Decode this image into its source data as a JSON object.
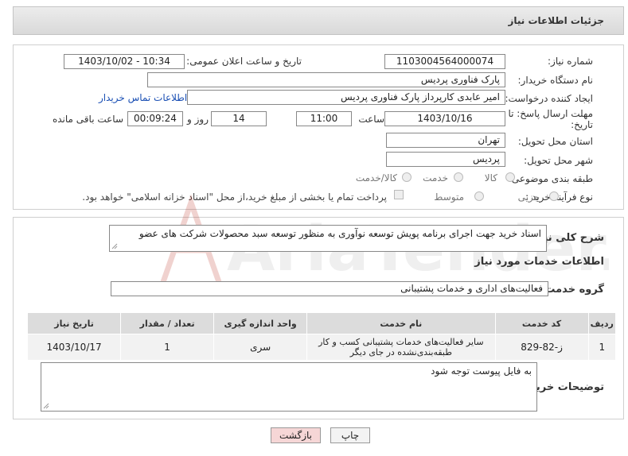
{
  "header": {
    "title": "جزئیات اطلاعات نیاز"
  },
  "fields": {
    "need_number_label": "شماره نیاز:",
    "need_number": "1103004564000074",
    "announce_label": "تاریخ و ساعت اعلان عمومی:",
    "announce_value": "1403/10/02 - 10:34",
    "buyer_org_label": "نام دستگاه خریدار:",
    "buyer_org": "پارک فناوری پردیس",
    "requester_label": "ایجاد کننده درخواست:",
    "requester": "امیر عابدی کارپرداز پارک فناوری پردیس",
    "contact_link": "اطلاعات تماس خریدار",
    "deadline_label_1": "مهلت ارسال پاسخ: تا",
    "deadline_label_2": "تاریخ:",
    "deadline_date": "1403/10/16",
    "time_label": "ساعت",
    "deadline_time": "11:00",
    "days_value": "14",
    "days_label": "روز و",
    "remaining_time": "00:09:24",
    "remaining_label": "ساعت باقی مانده",
    "province_label": "استان محل تحویل:",
    "province": "تهران",
    "city_label": "شهر محل تحویل:",
    "city": "پردیس",
    "category_label": "طبقه بندی موضوعی:",
    "category_options": [
      "کالا",
      "خدمت",
      "کالا/خدمت"
    ],
    "process_label": "نوع فرآیند خرید :",
    "process_options": [
      "جزیی",
      "متوسط"
    ],
    "payment_note": "پرداخت تمام یا بخشی از مبلغ خرید،از محل \"اسناد خزانه اسلامی\" خواهد بود."
  },
  "description": {
    "label": "شرح کلی نیاز:",
    "text": "اسناد خرید جهت اجرای برنامه پویش توسعه نوآوری به منظور توسعه سبد محصولات شرکت های عضو"
  },
  "services": {
    "title": "اطلاعات خدمات مورد نیاز",
    "group_label": "گروه خدمت:",
    "group_value": "فعالیت‌های اداری و خدمات پشتیبانی",
    "columns": [
      "ردیف",
      "کد خدمت",
      "نام خدمت",
      "واحد اندازه گیری",
      "تعداد / مقدار",
      "تاریخ نیاز"
    ],
    "rows": [
      [
        "1",
        "ز-82-829",
        "سایر فعالیت‌های خدمات پشتیبانی کسب و کار طبقه‌بندی‌نشده در جای دیگر",
        "سری",
        "1",
        "1403/10/17"
      ]
    ]
  },
  "buyer_notes": {
    "label": "توضیحات خریدار:",
    "text": "به فایل پیوست توجه شود"
  },
  "buttons": {
    "print": "چاپ",
    "back": "بازگشت"
  },
  "watermark": {
    "text": "AriaTender.neT"
  },
  "colors": {
    "link": "#1a4fb4",
    "back_button": "#f6d6d6",
    "watermark": "#c0392b"
  }
}
